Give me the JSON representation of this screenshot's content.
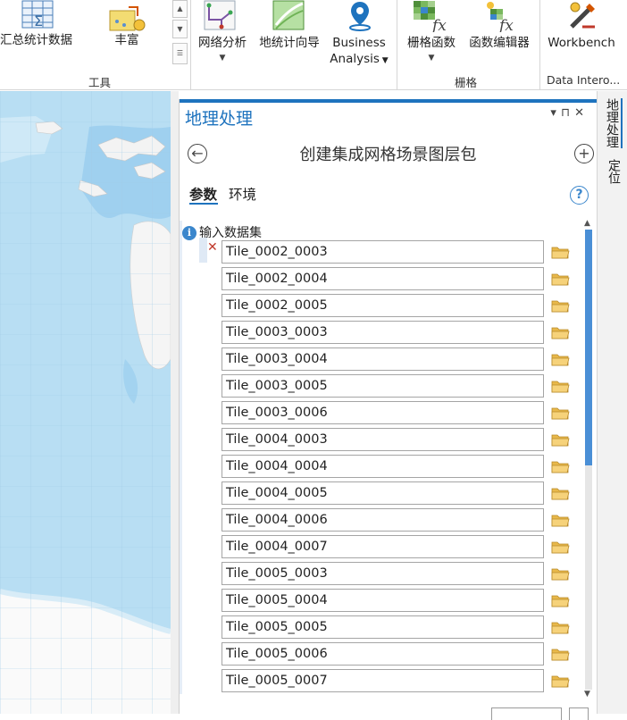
{
  "ribbon": {
    "buttons": {
      "summary_stats": "汇总统计数据",
      "enrich": "丰富",
      "network_analysis": "网络分析",
      "geostat_wizard": "地统计向导",
      "business_analysis_1": "Business",
      "business_analysis_2": "Analysis",
      "raster_functions": "栅格函数",
      "function_editor": "函数编辑器",
      "workbench": "Workbench"
    },
    "groups": {
      "tools": "工具",
      "raster": "栅格",
      "data_interop": "Data Intero..."
    }
  },
  "pane": {
    "title": "地理处理",
    "tool_title": "创建集成网格场景图层包",
    "tabs": {
      "parameters": "参数",
      "environments": "环境"
    },
    "help": "?",
    "param_label": "输入数据集",
    "datasets": [
      "Tile_0002_0003",
      "Tile_0002_0004",
      "Tile_0002_0005",
      "Tile_0003_0003",
      "Tile_0003_0004",
      "Tile_0003_0005",
      "Tile_0003_0006",
      "Tile_0004_0003",
      "Tile_0004_0004",
      "Tile_0004_0005",
      "Tile_0004_0006",
      "Tile_0004_0007",
      "Tile_0005_0003",
      "Tile_0005_0004",
      "Tile_0005_0005",
      "Tile_0005_0006",
      "Tile_0005_0007"
    ]
  },
  "side_tabs": {
    "geoprocessing": "地理处理",
    "locate": "定位"
  },
  "colors": {
    "accent": "#1e73be",
    "folder": "#e8b84a",
    "remove": "#c0392b",
    "ocean": "#b8def3",
    "land": "#fafafa"
  },
  "icons": [
    "summary-stats-icon",
    "enrich-icon",
    "network-analysis-icon",
    "geostat-wizard-icon",
    "business-analysis-icon",
    "raster-functions-icon",
    "function-editor-icon",
    "workbench-icon",
    "back-icon",
    "add-icon",
    "help-icon",
    "info-icon",
    "folder-icon",
    "remove-icon"
  ]
}
